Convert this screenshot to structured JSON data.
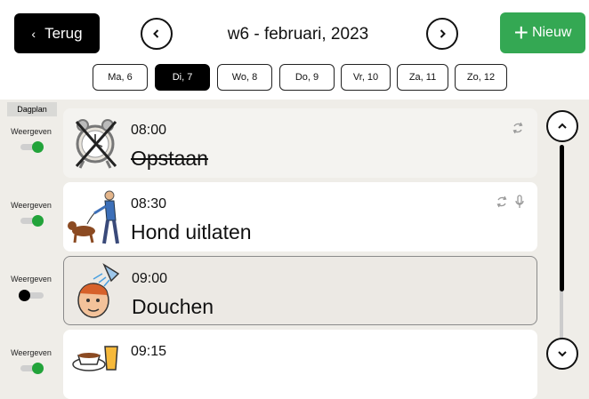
{
  "header": {
    "back_label": "Terug",
    "back_chevron": "‹",
    "prev_chevron": "‹",
    "next_chevron": "›",
    "week_title": "w6 - februari, 2023",
    "new_label": "Nieuw",
    "new_plus": "+"
  },
  "days": [
    {
      "label": "Ma, 6",
      "active": false
    },
    {
      "label": "Di, 7",
      "active": true
    },
    {
      "label": "Wo, 8",
      "active": false
    },
    {
      "label": "Do, 9",
      "active": false
    },
    {
      "label": "Vr, 10",
      "active": false
    },
    {
      "label": "Za, 11",
      "active": false
    },
    {
      "label": "Zo, 12",
      "active": false
    }
  ],
  "sidebar": {
    "dagplan_label": "Dagplan",
    "show_label": "Weergeven"
  },
  "activities": [
    {
      "time": "08:00",
      "title": "Opstaan",
      "done": true,
      "visible": true,
      "icons": [
        "repeat-icon"
      ]
    },
    {
      "time": "08:30",
      "title": "Hond uitlaten",
      "done": false,
      "visible": true,
      "icons": [
        "repeat-icon",
        "microphone-icon"
      ]
    },
    {
      "time": "09:00",
      "title": "Douchen",
      "done": false,
      "visible": false,
      "icons": []
    },
    {
      "time": "09:15",
      "title": "",
      "done": false,
      "visible": true,
      "icons": []
    }
  ],
  "colors": {
    "accent_green": "#34a853",
    "toggle_on": "#22a33a",
    "toggle_off": "#000000"
  },
  "scroll": {
    "up_chevron": "⌃",
    "down_chevron": "⌄"
  }
}
